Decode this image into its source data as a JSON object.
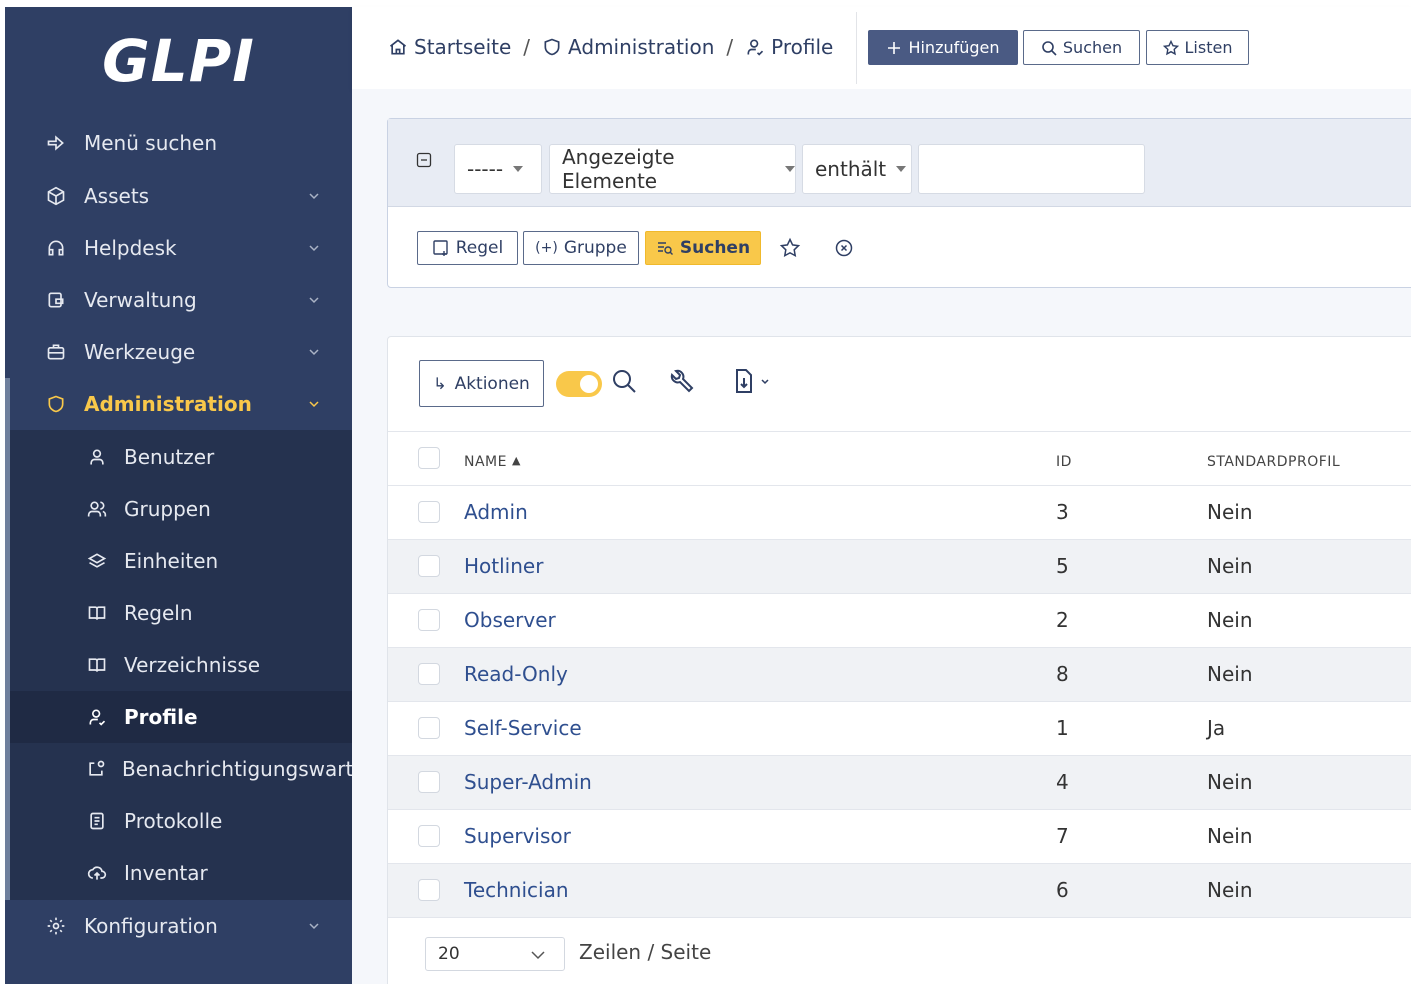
{
  "app": {
    "logo": "GLPI"
  },
  "sidebar": {
    "items": [
      {
        "label": "Menü suchen",
        "icon": "arrow-right-icon"
      },
      {
        "label": "Assets",
        "icon": "box-icon"
      },
      {
        "label": "Helpdesk",
        "icon": "headset-icon"
      },
      {
        "label": "Verwaltung",
        "icon": "wallet-icon"
      },
      {
        "label": "Werkzeuge",
        "icon": "briefcase-icon"
      },
      {
        "label": "Administration",
        "icon": "shield-icon"
      },
      {
        "label": "Konfiguration",
        "icon": "gear-icon"
      }
    ],
    "sub_items": [
      {
        "label": "Benutzer",
        "icon": "user-icon"
      },
      {
        "label": "Gruppen",
        "icon": "users-icon"
      },
      {
        "label": "Einheiten",
        "icon": "layers-icon"
      },
      {
        "label": "Regeln",
        "icon": "book-icon"
      },
      {
        "label": "Verzeichnisse",
        "icon": "book-icon"
      },
      {
        "label": "Profile",
        "icon": "user-check-icon"
      },
      {
        "label": "Benachrichtigungswarte",
        "icon": "notification-icon"
      },
      {
        "label": "Protokolle",
        "icon": "log-icon"
      },
      {
        "label": "Inventar",
        "icon": "cloud-upload-icon"
      }
    ],
    "accent_color": "#f9c84a"
  },
  "header": {
    "breadcrumb": [
      "Startseite",
      "Administration",
      "Profile"
    ],
    "separator": "/",
    "add_label": "Hinzufügen",
    "search_label": "Suchen",
    "lists_label": "Listen"
  },
  "search": {
    "field_select": "-----",
    "field_name": "Angezeigte Elemente",
    "operator": "enthält",
    "value": "",
    "rule_label": "Regel",
    "group_label": "Gruppe",
    "search_label": "Suchen"
  },
  "results": {
    "actions_label": "Aktionen",
    "columns": {
      "name": "NAME",
      "id": "ID",
      "default": "STANDARDPROFIL"
    },
    "rows": [
      {
        "name": "Admin",
        "id": "3",
        "default": "Nein"
      },
      {
        "name": "Hotliner",
        "id": "5",
        "default": "Nein"
      },
      {
        "name": "Observer",
        "id": "2",
        "default": "Nein"
      },
      {
        "name": "Read-Only",
        "id": "8",
        "default": "Nein"
      },
      {
        "name": "Self-Service",
        "id": "1",
        "default": "Ja"
      },
      {
        "name": "Super-Admin",
        "id": "4",
        "default": "Nein"
      },
      {
        "name": "Supervisor",
        "id": "7",
        "default": "Nein"
      },
      {
        "name": "Technician",
        "id": "6",
        "default": "Nein"
      }
    ],
    "page_size": "20",
    "page_size_label": "Zeilen / Seite"
  }
}
